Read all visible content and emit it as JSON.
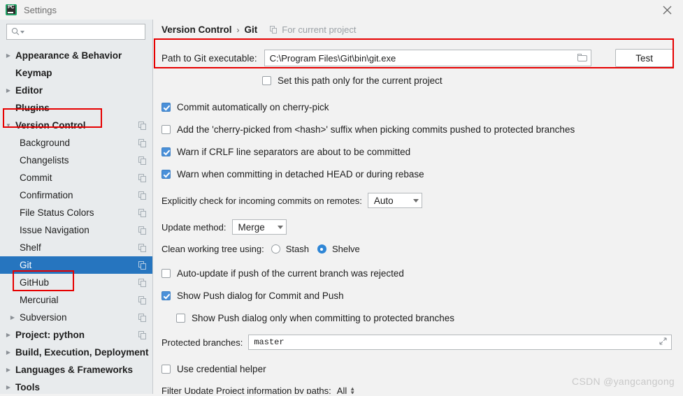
{
  "window": {
    "title": "Settings",
    "logo_icon": "pycharm-logo-icon",
    "close_icon": "close-icon"
  },
  "sidebar": {
    "search": {
      "value": "",
      "placeholder": "",
      "icon": "search-icon"
    },
    "items": [
      {
        "label": "Appearance & Behavior",
        "level": 0,
        "bold": true,
        "arrow": "right",
        "copy": false,
        "selected": false
      },
      {
        "label": "Keymap",
        "level": 0,
        "bold": true,
        "arrow": "none",
        "copy": false,
        "selected": false
      },
      {
        "label": "Editor",
        "level": 0,
        "bold": true,
        "arrow": "right",
        "copy": false,
        "selected": false
      },
      {
        "label": "Plugins",
        "level": 0,
        "bold": true,
        "arrow": "none",
        "copy": false,
        "selected": false
      },
      {
        "label": "Version Control",
        "level": 0,
        "bold": true,
        "arrow": "down",
        "copy": true,
        "selected": false
      },
      {
        "label": "Background",
        "level": 1,
        "bold": false,
        "arrow": "none",
        "copy": true,
        "selected": false
      },
      {
        "label": "Changelists",
        "level": 1,
        "bold": false,
        "arrow": "none",
        "copy": true,
        "selected": false
      },
      {
        "label": "Commit",
        "level": 1,
        "bold": false,
        "arrow": "none",
        "copy": true,
        "selected": false
      },
      {
        "label": "Confirmation",
        "level": 1,
        "bold": false,
        "arrow": "none",
        "copy": true,
        "selected": false
      },
      {
        "label": "File Status Colors",
        "level": 1,
        "bold": false,
        "arrow": "none",
        "copy": true,
        "selected": false
      },
      {
        "label": "Issue Navigation",
        "level": 1,
        "bold": false,
        "arrow": "none",
        "copy": true,
        "selected": false
      },
      {
        "label": "Shelf",
        "level": 1,
        "bold": false,
        "arrow": "none",
        "copy": true,
        "selected": false
      },
      {
        "label": "Git",
        "level": 1,
        "bold": false,
        "arrow": "none",
        "copy": true,
        "selected": true
      },
      {
        "label": "GitHub",
        "level": 1,
        "bold": false,
        "arrow": "none",
        "copy": true,
        "selected": false
      },
      {
        "label": "Mercurial",
        "level": 1,
        "bold": false,
        "arrow": "none",
        "copy": true,
        "selected": false
      },
      {
        "label": "Subversion",
        "level": 1,
        "bold": false,
        "arrow": "right",
        "copy": true,
        "selected": false
      },
      {
        "label": "Project: python",
        "level": 0,
        "bold": true,
        "arrow": "right",
        "copy": true,
        "selected": false
      },
      {
        "label": "Build, Execution, Deployment",
        "level": 0,
        "bold": true,
        "arrow": "right",
        "copy": false,
        "selected": false
      },
      {
        "label": "Languages & Frameworks",
        "level": 0,
        "bold": true,
        "arrow": "right",
        "copy": false,
        "selected": false
      },
      {
        "label": "Tools",
        "level": 0,
        "bold": true,
        "arrow": "right",
        "copy": false,
        "selected": false
      }
    ]
  },
  "panel": {
    "breadcrumb_root": "Version Control",
    "breadcrumb_sep": "›",
    "breadcrumb_leaf": "Git",
    "for_current_project": "For current project",
    "for_current_project_icon": "copy-settings-icon",
    "path_label": "Path to Git executable:",
    "path_value": "C:\\Program Files\\Git\\bin\\git.exe",
    "browse_icon": "folder-icon",
    "test_button": "Test",
    "set_path_only": "Set this path only for the current project",
    "set_path_only_checked": false,
    "commit_cherry_pick": "Commit automatically on cherry-pick",
    "commit_cherry_pick_checked": true,
    "add_suffix": "Add the 'cherry-picked from <hash>' suffix when picking commits pushed to protected branches",
    "add_suffix_checked": false,
    "warn_crlf": "Warn if CRLF line separators are about to be committed",
    "warn_crlf_checked": true,
    "warn_detached": "Warn when committing in detached HEAD or during rebase",
    "warn_detached_checked": true,
    "explicit_check_label": "Explicitly check for incoming commits on remotes:",
    "explicit_check_value": "Auto",
    "update_method_label": "Update method:",
    "update_method_value": "Merge",
    "clean_tree_label": "Clean working tree using:",
    "clean_tree_stash": "Stash",
    "clean_tree_shelve": "Shelve",
    "clean_tree_selected": "Shelve",
    "auto_update": "Auto-update if push of the current branch was rejected",
    "auto_update_checked": false,
    "show_push_dialog": "Show Push dialog for Commit and Push",
    "show_push_dialog_checked": true,
    "show_push_protected": "Show Push dialog only when committing to protected branches",
    "show_push_protected_checked": false,
    "protected_branches_label": "Protected branches:",
    "protected_branches_value": "master",
    "expand_icon": "expand-editor-icon",
    "use_credential_helper": "Use credential helper",
    "use_credential_helper_checked": false,
    "filter_label": "Filter Update Project information by paths:",
    "filter_value": "All"
  },
  "annotations": {
    "highlight_color": "#e60000",
    "selection_color": "#2675bf",
    "checkbox_color": "#4a90d9"
  },
  "watermark": "CSDN @yangcangong"
}
